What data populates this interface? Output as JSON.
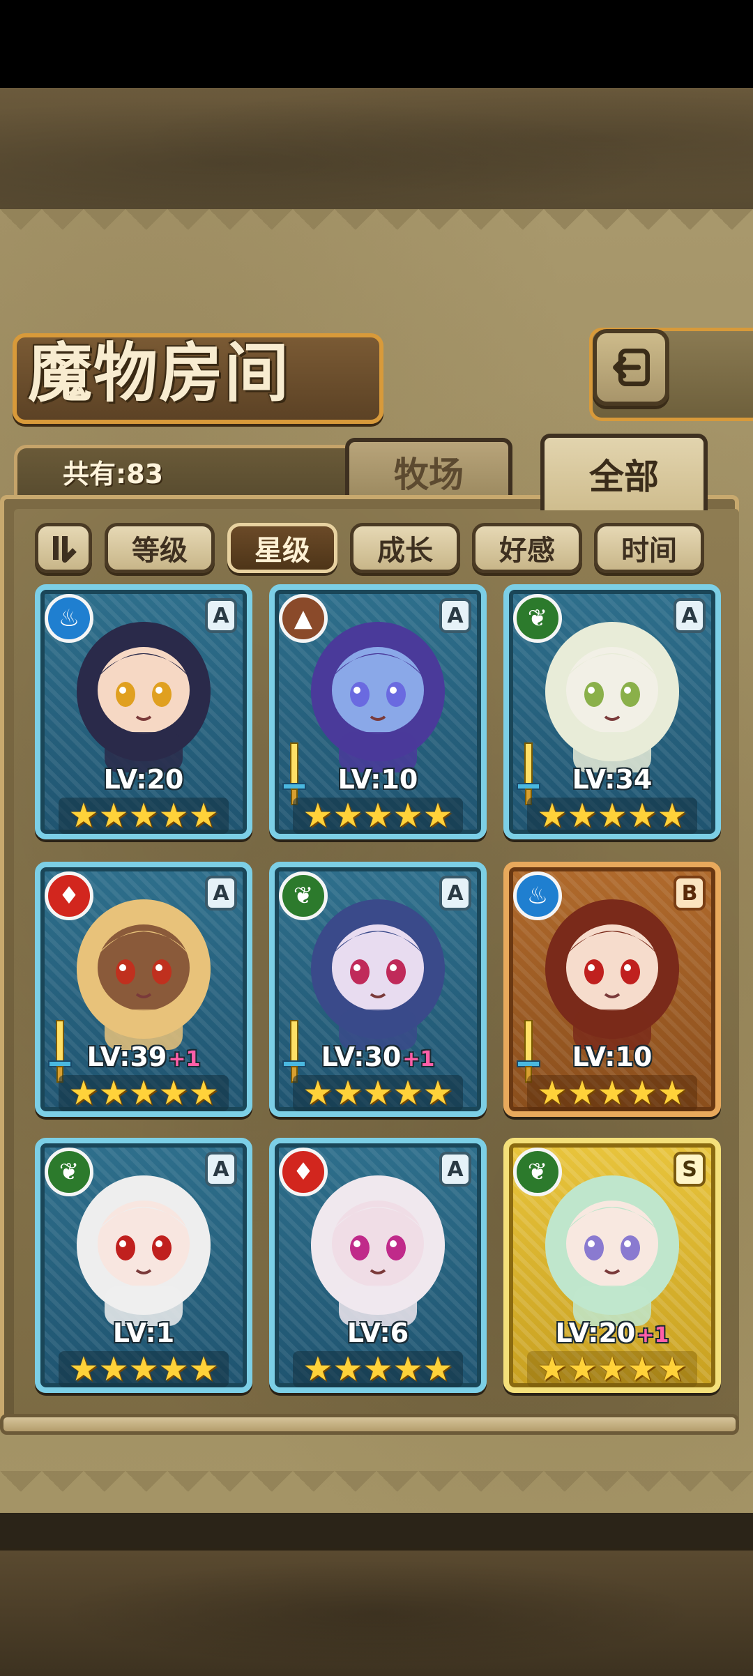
{
  "screen": {
    "title": "魔物房间",
    "count_label": "共有:83"
  },
  "tabs": [
    {
      "label": "牧场",
      "active": false
    },
    {
      "label": "全部",
      "active": true
    }
  ],
  "sort": {
    "toggle_icon": "order-toggle-icon",
    "buttons": [
      {
        "label": "等级",
        "active": false
      },
      {
        "label": "星级",
        "active": true
      },
      {
        "label": "成长",
        "active": false
      },
      {
        "label": "好感",
        "active": false
      },
      {
        "label": "时间",
        "active": false
      }
    ]
  },
  "colors": {
    "accent_gold": "#d89a3a",
    "active_sort": "#4e3518",
    "star": "#ffd23a",
    "bonus_pink": "#ff5fa8"
  },
  "monsters": [
    {
      "element": "water",
      "element_glyph": "♨",
      "rank": "A",
      "level": "LV:20",
      "bonus": "",
      "stars": "★★★★★",
      "frame": "blue",
      "sword": false
    },
    {
      "element": "earth",
      "element_glyph": "▲",
      "rank": "A",
      "level": "LV:10",
      "bonus": "",
      "stars": "★★★★★",
      "frame": "blue",
      "sword": true
    },
    {
      "element": "wood",
      "element_glyph": "❦",
      "rank": "A",
      "level": "LV:34",
      "bonus": "",
      "stars": "★★★★★",
      "frame": "blue",
      "sword": true
    },
    {
      "element": "fire",
      "element_glyph": "♦",
      "rank": "A",
      "level": "LV:39",
      "bonus": "+1",
      "stars": "★★★★★",
      "frame": "blue",
      "sword": true
    },
    {
      "element": "wood",
      "element_glyph": "❦",
      "rank": "A",
      "level": "LV:30",
      "bonus": "+1",
      "stars": "★★★★★",
      "frame": "blue",
      "sword": true
    },
    {
      "element": "water",
      "element_glyph": "♨",
      "rank": "B",
      "level": "LV:10",
      "bonus": "",
      "stars": "★★★★★",
      "frame": "bronze",
      "sword": true
    },
    {
      "element": "wood",
      "element_glyph": "❦",
      "rank": "A",
      "level": "LV:1",
      "bonus": "",
      "stars": "★★★★★",
      "frame": "blue",
      "sword": false
    },
    {
      "element": "fire",
      "element_glyph": "♦",
      "rank": "A",
      "level": "LV:6",
      "bonus": "",
      "stars": "★★★★★",
      "frame": "blue",
      "sword": false
    },
    {
      "element": "wood",
      "element_glyph": "❦",
      "rank": "S",
      "level": "LV:20",
      "bonus": "+1",
      "stars": "★★★★★",
      "frame": "gold",
      "sword": false
    }
  ]
}
